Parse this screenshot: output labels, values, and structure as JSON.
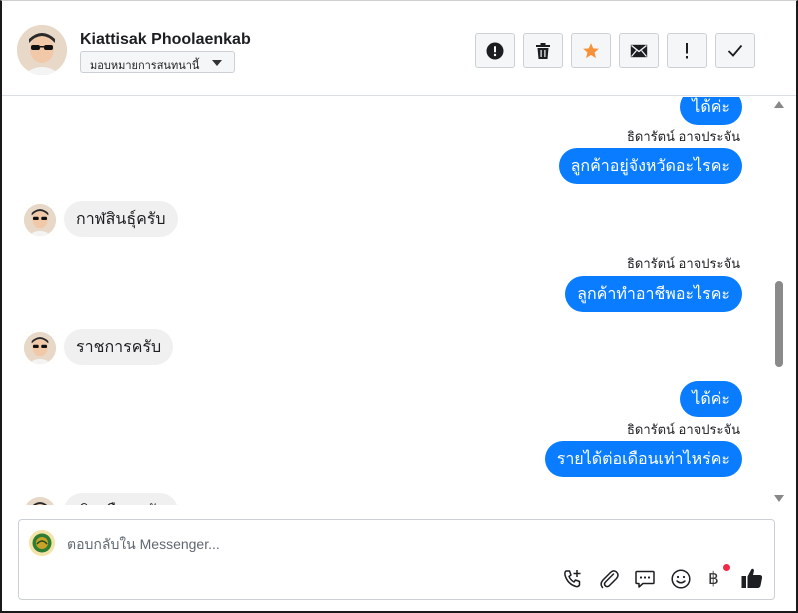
{
  "header": {
    "contact_name": "Kiattisak Phoolaenkab",
    "assign_label": "มอบหมายการสนทนานี้",
    "tools": [
      {
        "icon": "alert-circle-icon"
      },
      {
        "icon": "trash-icon"
      },
      {
        "icon": "star-icon",
        "color": "#f7923b"
      },
      {
        "icon": "envelope-icon"
      },
      {
        "icon": "exclamation-icon"
      },
      {
        "icon": "checkmark-icon"
      }
    ]
  },
  "messages": [
    {
      "direction": "out",
      "text": "ได้ค่ะ"
    },
    {
      "direction": "out",
      "sender": "ธิดารัตน์ อาจประจัน",
      "text": "ลูกค้าอยู่จังหวัดอะไรคะ"
    },
    {
      "direction": "in",
      "text": "กาฬสินธุ์ครับ"
    },
    {
      "direction": "out",
      "sender": "ธิดารัตน์ อาจประจัน",
      "text": "ลูกค้าทำอาชีพอะไรคะ"
    },
    {
      "direction": "in",
      "text": "ราชการครับ"
    },
    {
      "direction": "out",
      "text": "ได้ค่ะ"
    },
    {
      "direction": "out",
      "sender": "ธิดารัตน์ อาจประจัน",
      "text": "รายได้ต่อเดือนเท่าไหร่คะ"
    },
    {
      "direction": "in",
      "text": "เงินเดือนครับ"
    }
  ],
  "composer": {
    "placeholder": "ตอบกลับใน Messenger...",
    "baht_symbol": "฿"
  },
  "colors": {
    "outgoing_bubble": "#0a7cff",
    "incoming_bubble": "#f0f0f0",
    "notification_dot": "#f02849"
  }
}
